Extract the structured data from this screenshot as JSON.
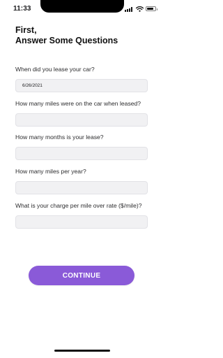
{
  "status_bar": {
    "time": "11:33",
    "signal_icon": "cellular-signal-icon",
    "wifi_icon": "wifi-icon",
    "battery_icon": "battery-icon",
    "battery_level": 0.85
  },
  "heading": {
    "line1": "First,",
    "line2": "Answer Some Questions"
  },
  "questions": [
    {
      "label": "When did you lease your car?",
      "value": "6/26/2021",
      "placeholder": ""
    },
    {
      "label": "How many miles were on the car when leased?",
      "value": "",
      "placeholder": ""
    },
    {
      "label": "How many months is your lease?",
      "value": "",
      "placeholder": ""
    },
    {
      "label": "How many miles per year?",
      "value": "",
      "placeholder": ""
    },
    {
      "label": "What is your charge per mile over rate ($/mile)?",
      "value": "",
      "placeholder": ""
    }
  ],
  "continue_button": {
    "label": "CONTINUE"
  },
  "colors": {
    "accent": "#8a5ad8",
    "input_background": "#f1f1f3",
    "text": "#1c1c1e"
  }
}
